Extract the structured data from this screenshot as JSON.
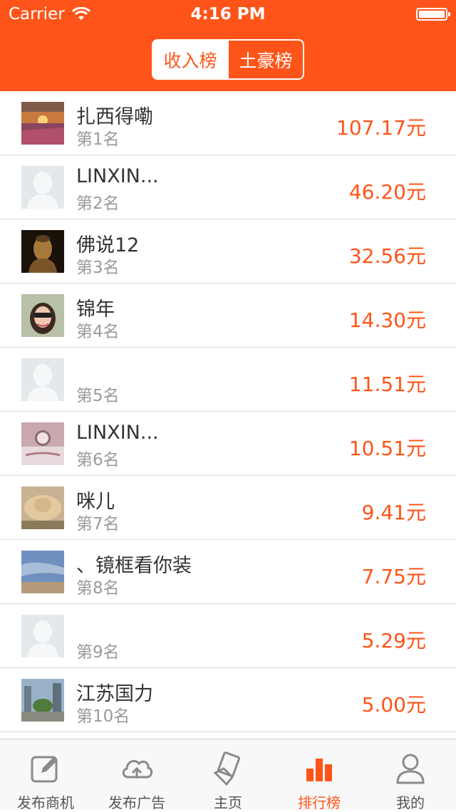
{
  "status_bar": {
    "carrier": "Carrier",
    "time": "4:16 PM"
  },
  "segmented": {
    "tab_income": "收入榜",
    "tab_rich": "土豪榜"
  },
  "colors": {
    "accent": "#ff5419",
    "avatar_placeholder": "#e4e8ea"
  },
  "rankings": [
    {
      "name": "扎西得嘞",
      "rank": "第1名",
      "amount": "107.17元",
      "avatar": "sunset-photo"
    },
    {
      "name": "LINXIN...",
      "rank": "第2名",
      "amount": "46.20元",
      "avatar": "default-avatar"
    },
    {
      "name": "佛说12",
      "rank": "第3名",
      "amount": "32.56元",
      "avatar": "buddha-photo"
    },
    {
      "name": "锦年",
      "rank": "第4名",
      "amount": "14.30元",
      "avatar": "portrait-photo"
    },
    {
      "name": "",
      "rank": "第5名",
      "amount": "11.51元",
      "avatar": "default-avatar"
    },
    {
      "name": "LINXIN...",
      "rank": "第6名",
      "amount": "10.51元",
      "avatar": "watch-photo"
    },
    {
      "name": "咪儿",
      "rank": "第7名",
      "amount": "9.41元",
      "avatar": "hat-photo"
    },
    {
      "name": "、镜框看你装",
      "rank": "第8名",
      "amount": "7.75元",
      "avatar": "sky-photo"
    },
    {
      "name": "",
      "rank": "第9名",
      "amount": "5.29元",
      "avatar": "default-avatar"
    },
    {
      "name": "江苏国力",
      "rank": "第10名",
      "amount": "5.00元",
      "avatar": "city-photo"
    }
  ],
  "tabbar": {
    "items": [
      {
        "label": "发布商机",
        "icon": "compose-icon"
      },
      {
        "label": "发布广告",
        "icon": "cloud-upload-icon"
      },
      {
        "label": "主页",
        "icon": "card-hand-icon"
      },
      {
        "label": "排行榜",
        "icon": "bar-chart-icon",
        "active": true
      },
      {
        "label": "我的",
        "icon": "user-icon"
      }
    ]
  }
}
